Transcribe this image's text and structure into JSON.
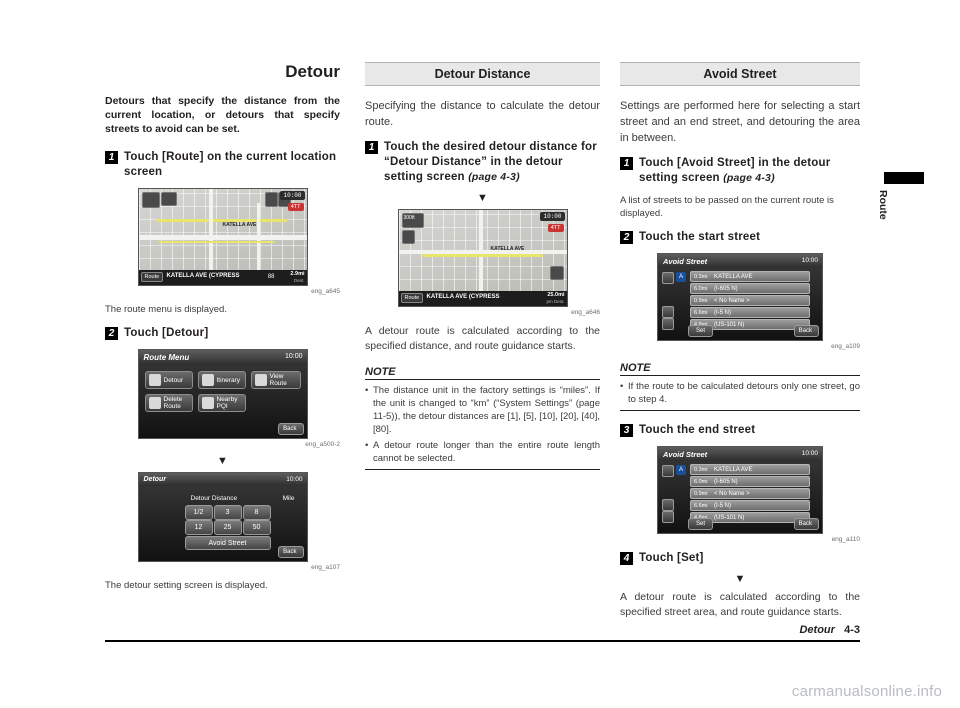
{
  "sideTab": {
    "label": "Route"
  },
  "footer": {
    "chapter": "Detour",
    "page": "4-3"
  },
  "watermark": "carmanualsonline.info",
  "col1": {
    "title": "Detour",
    "lead": "Detours that specify the distance from the current location, or detours that specify streets to avoid can be set.",
    "step1": {
      "num": "1",
      "text": "Touch [Route] on the current location screen"
    },
    "shot1": {
      "caption": "eng_a645",
      "clock": "10:00",
      "badge": "4TT",
      "routeButton": "Route",
      "street": "KATELLA AVE (CYPRESS",
      "corner": "88",
      "distance": "2.9mi",
      "distanceSub": "Dest."
    },
    "afterShot1": "The route menu is displayed.",
    "step2": {
      "num": "2",
      "text": "Touch [Detour]"
    },
    "shot2": {
      "caption": "eng_a500-2",
      "title": "Route Menu",
      "clock": "10:00",
      "buttons": [
        "Detour",
        "Itinerary",
        "View Route",
        "Delete Route",
        "Nearby PQI"
      ],
      "back": "Back"
    },
    "arrow": "▼",
    "shot3": {
      "caption": "eng_a107",
      "title": "Detour",
      "clock": "10:00",
      "label": "Detour Distance",
      "unit": "Mile",
      "values": [
        "1/2",
        "3",
        "8",
        "12",
        "25",
        "50"
      ],
      "avoidStreet": "Avoid Street",
      "back": "Back"
    },
    "afterShot3": "The detour setting screen is displayed."
  },
  "col2": {
    "head": "Detour Distance",
    "intro": "Specifying the distance to calculate the detour route.",
    "step1": {
      "num": "1",
      "text": "Touch the desired detour distance for “Detour Distance” in the detour setting screen",
      "ref": "(page 4-3)"
    },
    "arrow": "▼",
    "shot": {
      "caption": "eng_a646",
      "clock": "10:00",
      "badge": "4TT",
      "distBadge": "300ft",
      "routeButton": "Route",
      "street": "KATELLA AVE (CYPRESS",
      "eta": "25.0mi",
      "etaSub": "pm Dest."
    },
    "after": "A detour route is calculated according to the specified distance, and route guidance starts.",
    "note": {
      "title": "NOTE",
      "items": [
        "The distance unit in the factory settings is “miles”. If the unit is changed to “km” (“System Settings” (page 11-5)), the detour distances are [1], [5], [10], [20], [40], [80].",
        "A detour route longer than the entire route length cannot be selected."
      ]
    }
  },
  "col3": {
    "head": "Avoid Street",
    "intro": "Settings are performed here for selecting a start street and an end street, and detouring the area in between.",
    "step1": {
      "num": "1",
      "text": "Touch [Avoid Street] in the detour setting screen",
      "ref": "(page 4-3)"
    },
    "after1": "A list of streets to be passed on the current route is displayed.",
    "step2": {
      "num": "2",
      "text": "Touch the start street"
    },
    "shot2": {
      "caption": "eng_a109",
      "title": "Avoid Street",
      "clock": "10:00",
      "rows": [
        {
          "dist": "0.3mi",
          "name": "KATELLA AVE"
        },
        {
          "dist": "6.0mi",
          "name": "(I-605 N)"
        },
        {
          "dist": "0.9mi",
          "name": "< No Name >"
        },
        {
          "dist": "6.6mi",
          "name": "(I-5 N)"
        },
        {
          "dist": "4.8mi",
          "name": "(US-101 N)"
        }
      ],
      "set": "Set",
      "back": "Back",
      "marker": "A"
    },
    "note": {
      "title": "NOTE",
      "items": [
        "If the route to be calculated detours only one street, go to step 4."
      ]
    },
    "step3": {
      "num": "3",
      "text": "Touch the end street"
    },
    "shot3": {
      "caption": "eng_a110",
      "title": "Avoid Street",
      "clock": "10:00",
      "rows": [
        {
          "dist": "0.3mi",
          "name": "KATELLA AVE"
        },
        {
          "dist": "6.0mi",
          "name": "(I-605 N)"
        },
        {
          "dist": "0.9mi",
          "name": "< No Name >"
        },
        {
          "dist": "6.6mi",
          "name": "(I-5 N)"
        },
        {
          "dist": "4.8mi",
          "name": "(US-101 N)"
        }
      ],
      "set": "Set",
      "back": "Back",
      "marker": "A"
    },
    "step4": {
      "num": "4",
      "text": "Touch [Set]"
    },
    "arrow": "▼",
    "after4": "A detour route is calculated according to the specified street area, and route guidance starts."
  }
}
